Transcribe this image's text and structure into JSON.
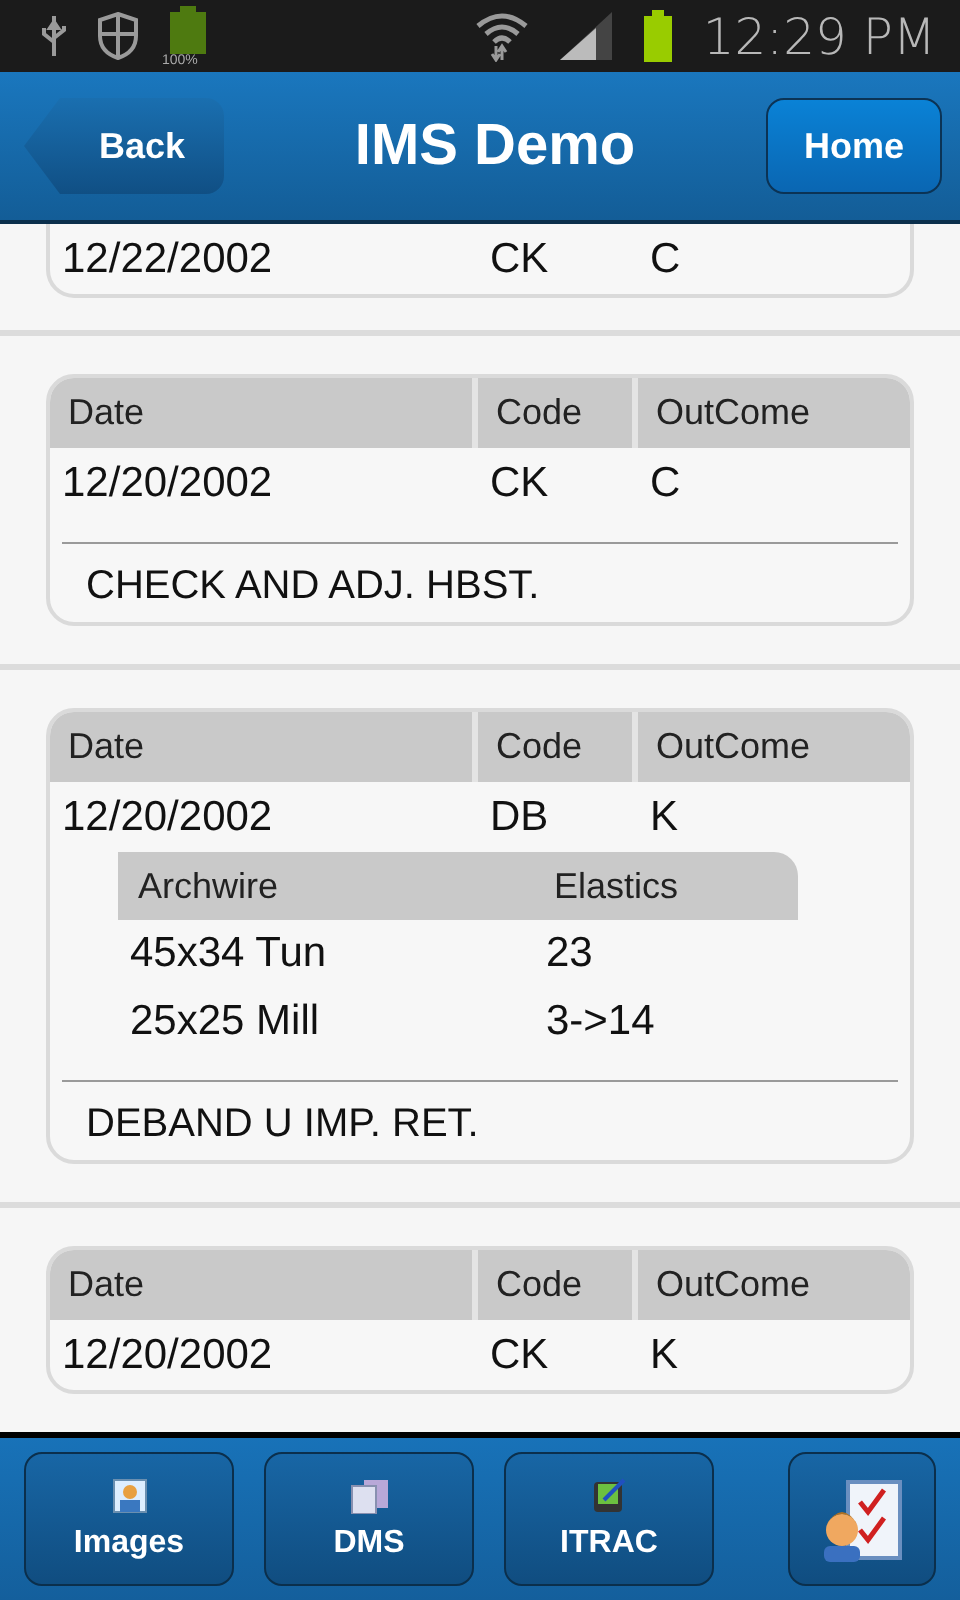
{
  "status_bar": {
    "battery_label": "100%",
    "time": "12:29 PM"
  },
  "header": {
    "back": "Back",
    "title": "IMS Demo",
    "home": "Home"
  },
  "visits": [
    {
      "kind": "cut",
      "row": {
        "date": "12/22/2002",
        "code": "CK",
        "outcome": "C"
      }
    },
    {
      "kind": "full",
      "columns": [
        "Date",
        "Code",
        "OutCome"
      ],
      "row": {
        "date": "12/20/2002",
        "code": "CK",
        "outcome": "C"
      },
      "note": "CHECK AND ADJ. HBST."
    },
    {
      "kind": "full",
      "columns": [
        "Date",
        "Code",
        "OutCome"
      ],
      "row": {
        "date": "12/20/2002",
        "code": "DB",
        "outcome": "K"
      },
      "wires": {
        "columns": [
          "Archwire",
          "Elastics"
        ],
        "rows": [
          [
            "45x34 Tun",
            "23"
          ],
          [
            "25x25 Mill",
            "3->14"
          ]
        ]
      },
      "note": "DEBAND U IMP. RET."
    },
    {
      "kind": "full",
      "columns": [
        "Date",
        "Code",
        "OutCome"
      ],
      "row": {
        "date": "12/20/2002",
        "code": "CK",
        "outcome": "K"
      }
    }
  ],
  "toolbar": [
    {
      "kind": "photo",
      "label": "Images"
    },
    {
      "kind": "docs",
      "label": "DMS"
    },
    {
      "kind": "tablet",
      "label": "ITRAC"
    },
    {
      "kind": "checklist"
    }
  ]
}
